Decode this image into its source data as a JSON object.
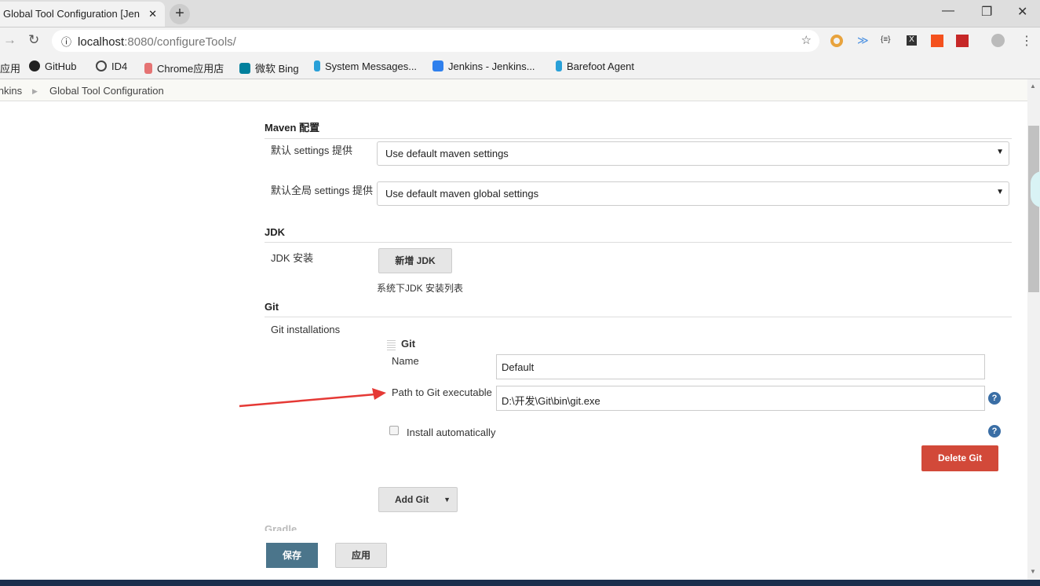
{
  "browser": {
    "tab_title": "Global Tool Configuration [Jen",
    "url_host": "localhost",
    "url_path": ":8080/configureTools/",
    "bookmarks": [
      "应用",
      "GitHub",
      "ID4",
      "Chrome应用店",
      "微软 Bing",
      "System Messages...",
      "Jenkins - Jenkins...",
      "Barefoot Agent"
    ]
  },
  "breadcrumb": [
    "Jenkins",
    "Global Tool Configuration"
  ],
  "maven": {
    "title": "Maven 配置",
    "settings_label": "默认 settings 提供",
    "settings_value": "Use default maven settings",
    "global_label": "默认全局 settings 提供",
    "global_value": "Use default maven global settings"
  },
  "jdk": {
    "title": "JDK",
    "install_label": "JDK 安装",
    "add_button": "新增 JDK",
    "hint": "系统下JDK 安装列表"
  },
  "git": {
    "title": "Git",
    "installations_label": "Git installations",
    "item_title": "Git",
    "name_label": "Name",
    "name_value": "Default",
    "path_label": "Path to Git executable",
    "path_value": "D:\\开发\\Git\\bin\\git.exe",
    "install_auto_label": "Install automatically",
    "install_auto_checked": false,
    "delete_button": "Delete Git",
    "add_button": "Add Git"
  },
  "gradle": {
    "title": "Gradle"
  },
  "footer": {
    "save": "保存",
    "apply": "应用"
  },
  "colors": {
    "save": "#4b758b",
    "delete": "#d24939",
    "annotation_arrow": "#e53935"
  }
}
